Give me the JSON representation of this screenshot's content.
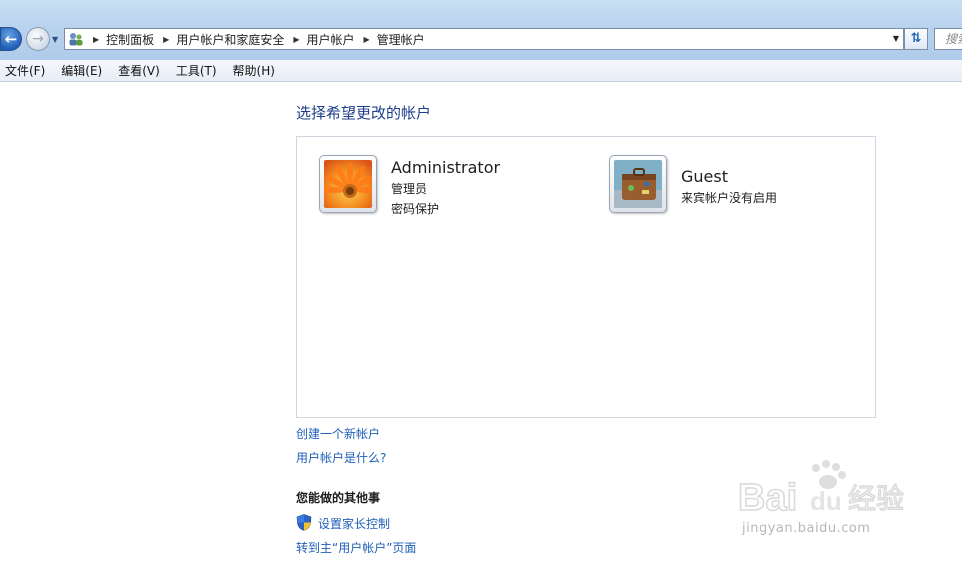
{
  "address_bar": {
    "crumbs": [
      "控制面板",
      "用户帐户和家庭安全",
      "用户帐户",
      "管理帐户"
    ]
  },
  "search": {
    "placeholder": "搜索"
  },
  "menu": [
    "文件(F)",
    "编辑(E)",
    "查看(V)",
    "工具(T)",
    "帮助(H)"
  ],
  "main": {
    "heading": "选择希望更改的帐户",
    "accounts": [
      {
        "name": "Administrator",
        "lines": [
          "管理员",
          "密码保护"
        ],
        "icon": "flower-avatar"
      },
      {
        "name": "Guest",
        "lines": [
          "来宾帐户没有启用"
        ],
        "icon": "suitcase-avatar"
      }
    ],
    "links": [
      "创建一个新帐户",
      "用户帐户是什么?"
    ],
    "other_tasks": {
      "title": "您能做的其他事",
      "items": [
        "设置家长控制",
        "转到主“用户帐户”页面"
      ]
    }
  },
  "watermark": {
    "brand": "Bai du 经验",
    "url": "jingyan.baidu.com"
  }
}
